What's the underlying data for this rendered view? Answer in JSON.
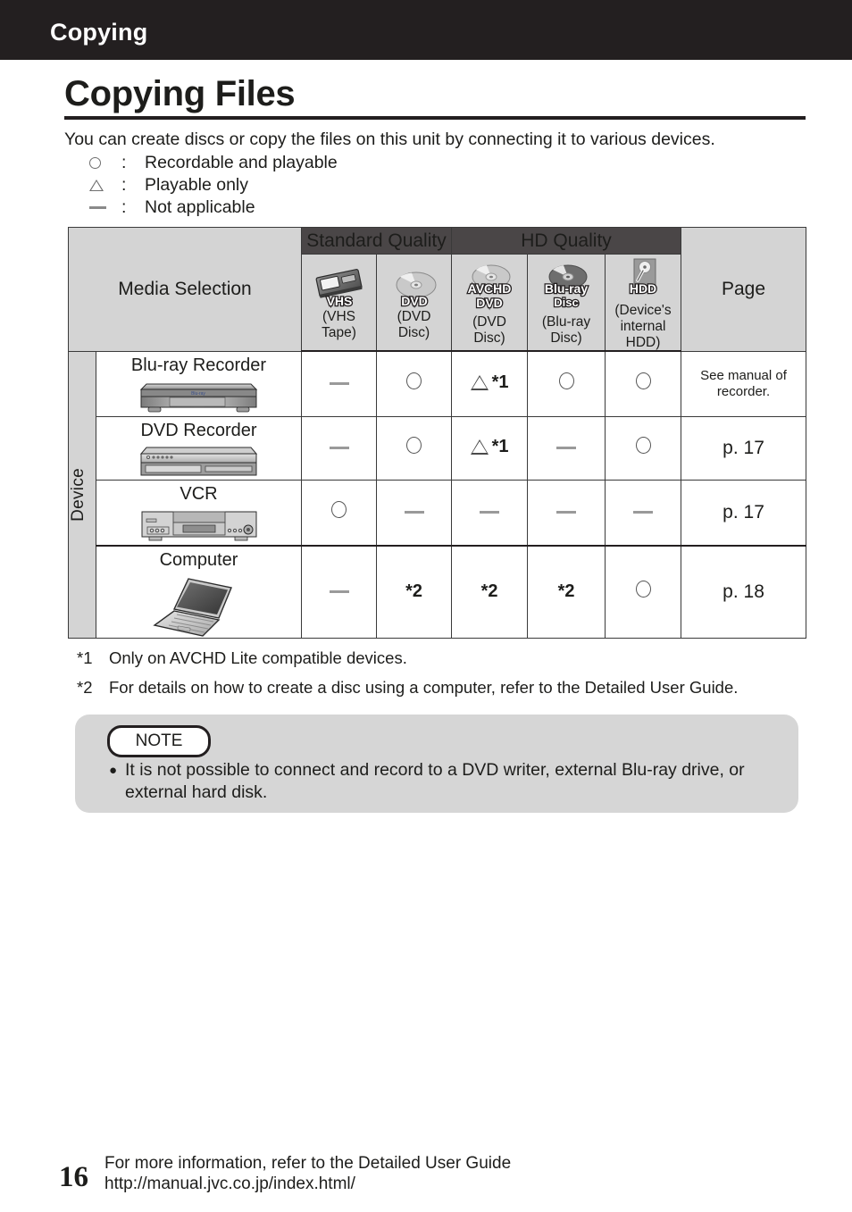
{
  "topbar": {
    "title": "Copying"
  },
  "page": {
    "title": "Copying Files",
    "intro": "You can create discs or copy the files on this unit by connecting it to various devices.",
    "number": "16"
  },
  "legend": {
    "colon": ":",
    "items": [
      {
        "symbol": "circle-icon",
        "label": "Recordable and playable"
      },
      {
        "symbol": "triangle-icon",
        "label": "Playable only"
      },
      {
        "symbol": "dash-icon",
        "label": "Not applicable"
      }
    ]
  },
  "table": {
    "device_axis_label": "Device",
    "media_selection_label": "Media Selection",
    "page_label": "Page",
    "quality_groups": [
      {
        "label": "Standard Quality",
        "span": 2
      },
      {
        "label": "HD Quality",
        "span": 3
      }
    ],
    "media_columns": [
      {
        "icon": "vhs-tape-icon",
        "badge": "VHS",
        "caption": "(VHS\nTape)",
        "cap1": "(VHS",
        "cap2": "Tape)",
        "cap3": ""
      },
      {
        "icon": "dvd-disc-icon",
        "badge": "DVD",
        "caption": "(DVD\nDisc)",
        "cap1": "(DVD",
        "cap2": "Disc)",
        "cap3": ""
      },
      {
        "icon": "avchd-dvd-icon",
        "badge": "AVCHD DVD",
        "caption": "(DVD\nDisc)",
        "cap1": "(DVD",
        "cap2": "Disc)",
        "cap3": ""
      },
      {
        "icon": "blu-ray-disc-icon",
        "badge": "Blu-ray Disc",
        "caption": "(Blu-ray\nDisc)",
        "cap1": "(Blu-ray",
        "cap2": "Disc)",
        "cap3": ""
      },
      {
        "icon": "hdd-icon",
        "badge": "HDD",
        "caption": "(Device's internal HDD)",
        "cap1": "(Device's",
        "cap2": "internal",
        "cap3": "HDD)"
      }
    ],
    "rows": [
      {
        "device": "Blu-ray Recorder",
        "device_icon": "blu-ray-recorder-icon",
        "cells": [
          "dash",
          "circle",
          "triangle-star1",
          "circle",
          "circle"
        ],
        "page": "See manual of recorder.",
        "page_style": "note"
      },
      {
        "device": "DVD Recorder",
        "device_icon": "dvd-recorder-icon",
        "cells": [
          "dash",
          "circle",
          "triangle-star1",
          "dash",
          "circle"
        ],
        "page": "p. 17",
        "page_style": "page"
      },
      {
        "device": "VCR",
        "device_icon": "vcr-icon",
        "cells": [
          "circle",
          "dash",
          "dash",
          "dash",
          "dash"
        ],
        "page": "p. 17",
        "page_style": "page"
      },
      {
        "device": "Computer",
        "device_icon": "computer-icon",
        "cells": [
          "dash",
          "star2",
          "star2",
          "star2",
          "circle"
        ],
        "page": "p. 18",
        "page_style": "page"
      }
    ],
    "star1_label": "*1",
    "star2_label": "*2"
  },
  "footnotes": [
    {
      "mark": "*1",
      "text": "Only on AVCHD Lite compatible devices."
    },
    {
      "mark": "*2",
      "text": "For details on how to create a disc using a computer, refer to the Detailed User Guide."
    }
  ],
  "note": {
    "heading": "NOTE",
    "bullet": "●",
    "text": "It is not possible to connect and record to a DVD writer, external Blu-ray drive, or external hard disk."
  },
  "footer": {
    "line1": "For more information, refer to the Detailed User Guide",
    "line2": "http://manual.jvc.co.jp/index.html/"
  },
  "colors": {
    "header_bar": "#231f20",
    "quality_header": "#4a4647",
    "table_header_fill": "#d4d4d4",
    "note_fill": "#d6d6d6",
    "text": "#1d1d1b"
  }
}
